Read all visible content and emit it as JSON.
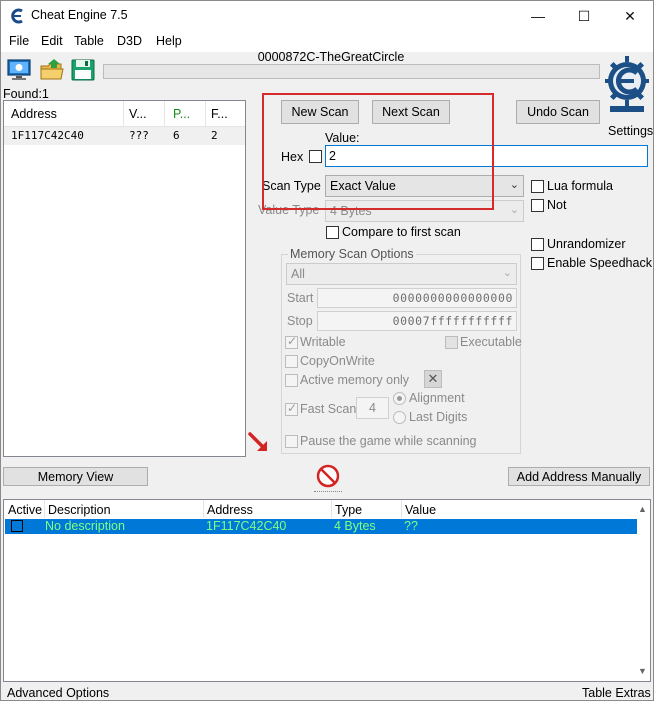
{
  "window": {
    "title": "Cheat Engine 7.5",
    "minimize_glyph": "—",
    "maximize_glyph": "☐",
    "close_glyph": "✕"
  },
  "menu": {
    "file": "File",
    "edit": "Edit",
    "table": "Table",
    "d3d": "D3D",
    "help": "Help"
  },
  "toolbar": {
    "icons": [
      "computer-process-icon",
      "open-folder-icon",
      "save-disk-icon"
    ]
  },
  "process": {
    "name": "0000872C-TheGreatCircle"
  },
  "results": {
    "found_label": "Found:1",
    "columns": [
      "Address",
      "V...",
      "P...",
      "F..."
    ],
    "rows": [
      {
        "address": "1F117C42C40",
        "value": "???",
        "previous": "6",
        "first": "2"
      }
    ]
  },
  "scan": {
    "new_scan": "New Scan",
    "next_scan": "Next Scan",
    "undo_scan": "Undo Scan",
    "settings": "Settings",
    "value_label": "Value:",
    "hex_label": "Hex",
    "value": "2",
    "scan_type_label": "Scan Type",
    "scan_type_value": "Exact Value",
    "value_type_label": "Value Type",
    "value_type_value": "4 Bytes",
    "compare_first": "Compare to first scan",
    "lua_formula": "Lua formula",
    "not_label": "Not",
    "unrandomizer": "Unrandomizer",
    "enable_speedhack": "Enable Speedhack"
  },
  "memory_scan_options": {
    "title": "Memory Scan Options",
    "region": "All",
    "start_label": "Start",
    "start_value": "0000000000000000",
    "stop_label": "Stop",
    "stop_value": "00007fffffffffff",
    "writable": "Writable",
    "executable": "Executable",
    "copy_on_write": "CopyOnWrite",
    "active_memory_only": "Active memory only",
    "fast_scan": "Fast Scan",
    "fast_scan_value": "4",
    "alignment": "Alignment",
    "last_digits": "Last Digits",
    "pause_game": "Pause the game while scanning"
  },
  "bottom_buttons": {
    "memory_view": "Memory View",
    "add_address_manually": "Add Address Manually"
  },
  "address_list": {
    "columns": [
      "Active",
      "Description",
      "Address",
      "Type",
      "Value"
    ],
    "rows": [
      {
        "description": "No description",
        "address": "1F117C42C40",
        "type": "4 Bytes",
        "value": "??"
      }
    ]
  },
  "status": {
    "advanced_options": "Advanced Options",
    "table_extras": "Table Extras"
  }
}
